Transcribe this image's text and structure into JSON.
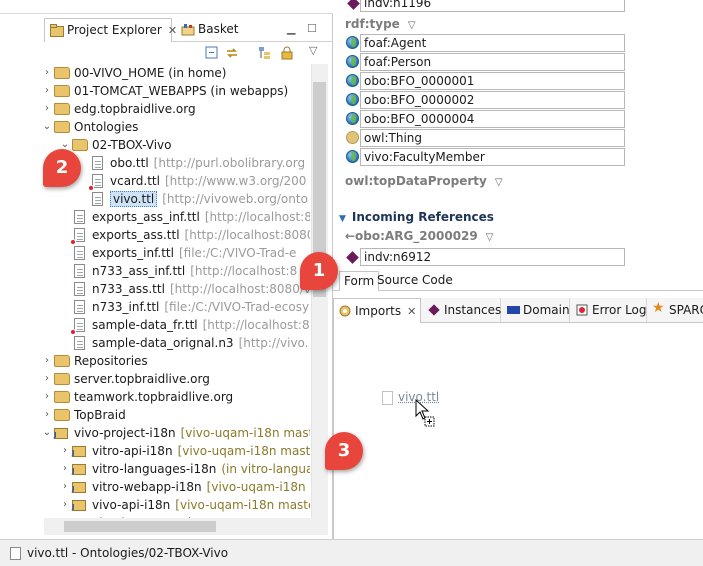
{
  "left": {
    "tabs": [
      {
        "label": "Project Explorer",
        "close": "✕"
      },
      {
        "label": "Basket"
      }
    ],
    "window_buttons": [
      "▭",
      "▭"
    ],
    "tree": [
      {
        "label": "00-VIVO_HOME (in home)",
        "kind": "folder",
        "arrow": "›"
      },
      {
        "label": "01-TOMCAT_WEBAPPS (in webapps)",
        "kind": "folder",
        "arrow": "›"
      },
      {
        "label": "edg.topbraidlive.org",
        "kind": "folder",
        "arrow": "›"
      },
      {
        "label": "Ontologies",
        "kind": "folder",
        "arrow": "⌄"
      },
      {
        "label": "02-TBOX-Vivo",
        "kind": "folder",
        "arrow": "⌄"
      },
      {
        "label": "obo.ttl",
        "kind": "file",
        "extra": "[http://purl.obolibrary.org"
      },
      {
        "label": "vcard.ttl",
        "kind": "file",
        "error": true,
        "extra": "[http://www.w3.org/200"
      },
      {
        "label": "vivo.ttl",
        "kind": "file",
        "selected": true,
        "extra": "[http://vivoweb.org/onto"
      },
      {
        "label": "exports_ass_inf.ttl",
        "kind": "file",
        "extra": "[http://localhost:80"
      },
      {
        "label": "exports_ass.ttl",
        "kind": "file",
        "error": true,
        "extra": "[http://localhost:8080/"
      },
      {
        "label": "exports_inf.ttl",
        "kind": "file",
        "extra": "[file:/C:/VIVO-Trad-e"
      },
      {
        "label": "n733_ass_inf.ttl",
        "kind": "file",
        "extra": "[http://localhost:8"
      },
      {
        "label": "n733_ass.ttl",
        "kind": "file",
        "extra": "[http://localhost:8080/vi"
      },
      {
        "label": "n733_inf.ttl",
        "kind": "file",
        "extra": "[file:/C:/VIVO-Trad-ecosy"
      },
      {
        "label": "sample-data_fr.ttl",
        "kind": "file",
        "error": true,
        "extra": "[http://localhost:80"
      },
      {
        "label": "sample-data_orignal.n3",
        "kind": "file",
        "extra": "[http://vivo."
      },
      {
        "label": "Repositories",
        "kind": "folder",
        "arrow": "›"
      },
      {
        "label": "server.topbraidlive.org",
        "kind": "folder",
        "arrow": "›"
      },
      {
        "label": "teamwork.topbraidlive.org",
        "kind": "folder",
        "arrow": "›"
      },
      {
        "label": "TopBraid",
        "kind": "folder",
        "arrow": "›"
      },
      {
        "label": "vivo-project-i18n",
        "kind": "project",
        "arrow": "⌄",
        "extra": "[vivo-uqam-i18n maste"
      },
      {
        "label": "vitro-api-i18n",
        "kind": "project",
        "arrow": "›",
        "extra": "[vivo-uqam-i18n maste"
      },
      {
        "label": "vitro-languages-i18n",
        "kind": "project",
        "arrow": "›",
        "extra": "(in vitro-languag"
      },
      {
        "label": "vitro-webapp-i18n",
        "kind": "project",
        "arrow": "›",
        "extra": "[vivo-uqam-i18n m"
      },
      {
        "label": "vivo-api-i18n",
        "kind": "project",
        "arrow": "›",
        "extra": "[vivo-uqam-i18n master"
      },
      {
        "label": "vivo-languages-i18n",
        "kind": "project",
        "arrow": "›",
        "extra": ""
      }
    ]
  },
  "right": {
    "top_value": "indv:n1196",
    "rdf_type_header": "rdf:type",
    "types": [
      {
        "label": "foaf:Agent",
        "icon": "globe"
      },
      {
        "label": "foaf:Person",
        "icon": "globe"
      },
      {
        "label": "obo:BFO_0000001",
        "icon": "globe"
      },
      {
        "label": "obo:BFO_0000002",
        "icon": "globe"
      },
      {
        "label": "obo:BFO_0000004",
        "icon": "globe"
      },
      {
        "label": "owl:Thing",
        "icon": "thing"
      },
      {
        "label": "vivo:FacultyMember",
        "icon": "globe"
      }
    ],
    "top_data_property": "owl:topDataProperty",
    "incoming_header": "Incoming References",
    "incoming_prop": "←obo:ARG_2000029",
    "incoming_value": "indv:n6912",
    "form_tabs": [
      "Form",
      "Source Code"
    ],
    "view_tabs": [
      {
        "label": "Imports",
        "close": "✕"
      },
      {
        "label": "Instances"
      },
      {
        "label": "Domain"
      },
      {
        "label": "Error Log"
      },
      {
        "label": "SPARQ"
      }
    ],
    "drag_label": "vivo.ttl"
  },
  "status": {
    "text": "vivo.ttl - Ontologies/02-TBOX-Vivo"
  },
  "callouts": [
    "2",
    "1",
    "3"
  ],
  "colors": {
    "accent": "#3b7fc4",
    "callout": "#e8453c",
    "diamond": "#6a1c5a"
  }
}
